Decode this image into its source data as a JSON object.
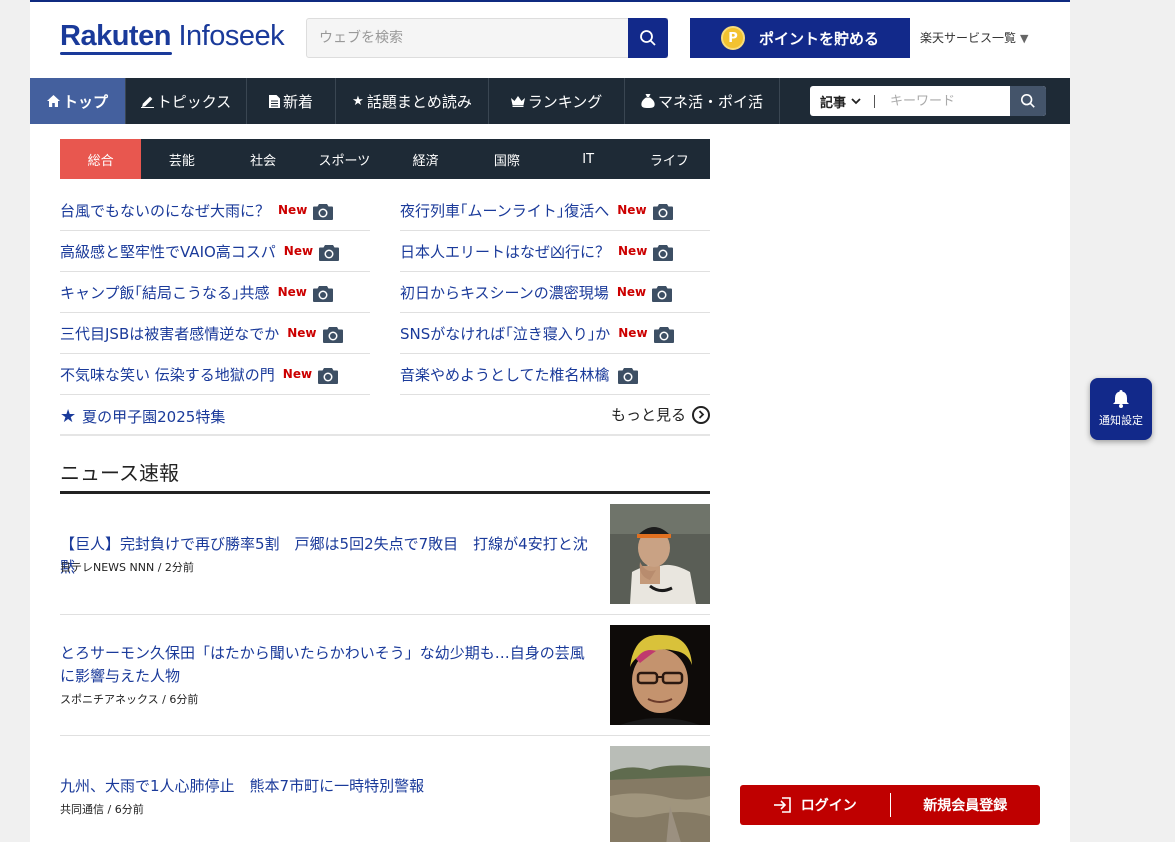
{
  "header": {
    "logo_bold": "Rakuten",
    "logo_light": " Infoseek",
    "search_placeholder": "ウェブを検索",
    "points_label": "ポイントを貯める",
    "coin_letter": "P",
    "services_label": "楽天サービス一覧",
    "services_arrow": "▼"
  },
  "nav": {
    "items": [
      {
        "label": "トップ",
        "icon": "home-icon"
      },
      {
        "label": "トピックス",
        "icon": "pencil-icon"
      },
      {
        "label": "新着",
        "icon": "document-icon"
      },
      {
        "label": "話題まとめ読み",
        "icon": "star-icon"
      },
      {
        "label": "ランキング",
        "icon": "crown-icon"
      },
      {
        "label": "マネ活・ポイ活",
        "icon": "money-bag-icon"
      }
    ],
    "search_select": "記事",
    "search_placeholder": "キーワード"
  },
  "categories": [
    "総合",
    "芸能",
    "社会",
    "スポーツ",
    "経済",
    "国際",
    "IT",
    "ライフ"
  ],
  "topics": {
    "left": [
      {
        "title": "台風でもないのになぜ大雨に？",
        "new": "New"
      },
      {
        "title": "高級感と堅牢性でVAIO高コスパ",
        "new": "New"
      },
      {
        "title": "キャンプ飯｢結局こうなる｣共感",
        "new": "New"
      },
      {
        "title": "三代目JSBは被害者感情逆なでか",
        "new": "New"
      },
      {
        "title": "不気味な笑い 伝染する地獄の門",
        "new": "New"
      }
    ],
    "right": [
      {
        "title": "夜行列車｢ムーンライト｣復活へ",
        "new": "New"
      },
      {
        "title": "日本人エリートはなぜ凶行に？",
        "new": "New"
      },
      {
        "title": "初日からキスシーンの濃密現場",
        "new": "New"
      },
      {
        "title": "SNSがなければ｢泣き寝入り｣か",
        "new": "New"
      },
      {
        "title": "音楽やめようとしてた椎名林檎",
        "new": ""
      }
    ],
    "special_label": "夏の甲子園2025特集",
    "more_label": "もっと見る"
  },
  "news": {
    "heading": "ニュース速報",
    "items": [
      {
        "title": "【巨人】完封負けで再び勝率5割　戸郷は5回2失点で7敗目　打線が4安打と沈黙",
        "source": "日テレNEWS NNN / 2分前"
      },
      {
        "title": "とろサーモン久保田「はたから聞いたらかわいそう」な幼少期も…自身の芸風に影響与えた人物",
        "source": "スポニチアネックス / 6分前"
      },
      {
        "title": "九州、大雨で1人心肺停止　熊本7市町に一時特別警報",
        "source": "共同通信 / 6分前"
      }
    ]
  },
  "floating": {
    "notify_label": "通知設定",
    "login_label": "ログイン",
    "register_label": "新規会員登録"
  },
  "colors": {
    "brand": "#12298a",
    "nav_bg": "#1e2a36",
    "active_category": "#e8574f",
    "new_badge": "#cc0000",
    "login_bar": "#bf0000"
  }
}
